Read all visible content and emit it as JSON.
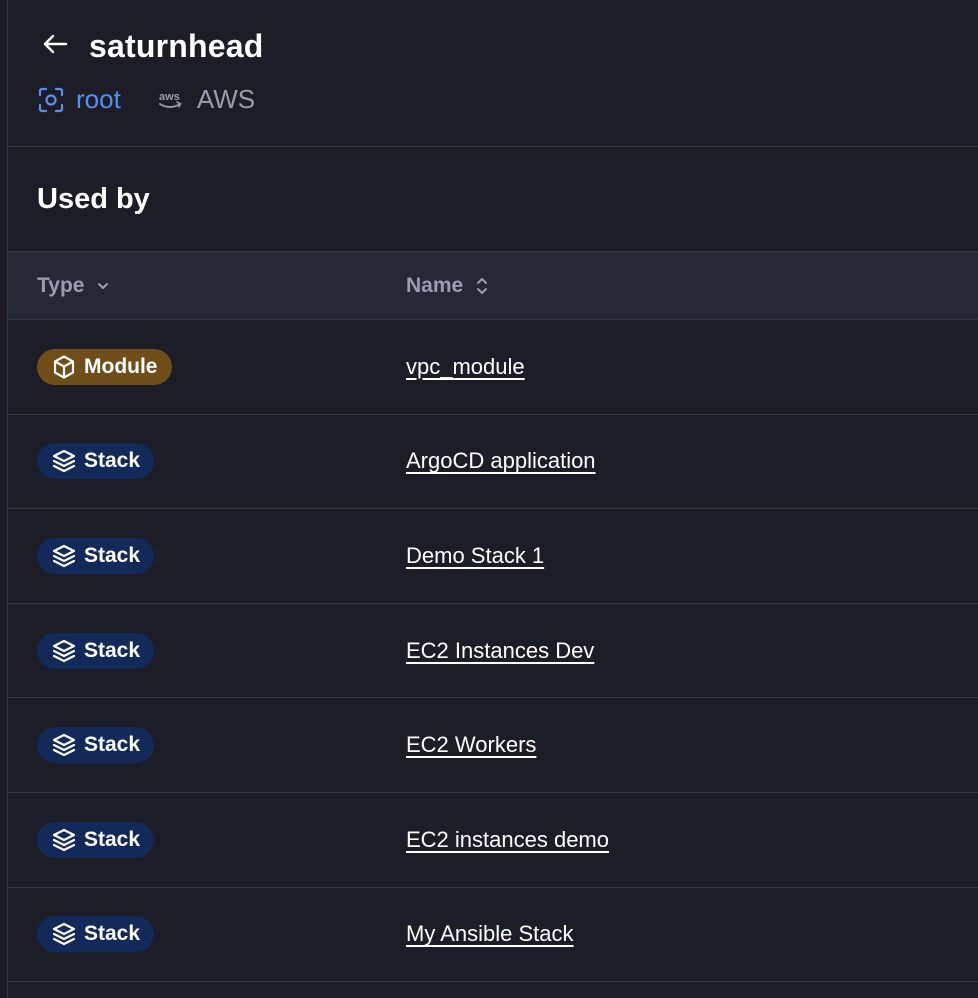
{
  "header": {
    "title": "saturnhead",
    "space": "root",
    "provider": "AWS"
  },
  "section": {
    "title": "Used by"
  },
  "table": {
    "columns": {
      "type": "Type",
      "name": "Name"
    },
    "rows": [
      {
        "type": "Module",
        "kind": "module",
        "name": "vpc_module"
      },
      {
        "type": "Stack",
        "kind": "stack",
        "name": "ArgoCD application"
      },
      {
        "type": "Stack",
        "kind": "stack",
        "name": "Demo Stack 1"
      },
      {
        "type": "Stack",
        "kind": "stack",
        "name": "EC2 Instances Dev"
      },
      {
        "type": "Stack",
        "kind": "stack",
        "name": "EC2 Workers"
      },
      {
        "type": "Stack",
        "kind": "stack",
        "name": "EC2 instances demo"
      },
      {
        "type": "Stack",
        "kind": "stack",
        "name": "My Ansible Stack"
      }
    ]
  },
  "colors": {
    "background": "#1c1d27",
    "header_row": "#262838",
    "module_badge": "#6f4e1a",
    "stack_badge": "#13295a",
    "space_link": "#5b8def",
    "muted": "#9a9cad"
  }
}
